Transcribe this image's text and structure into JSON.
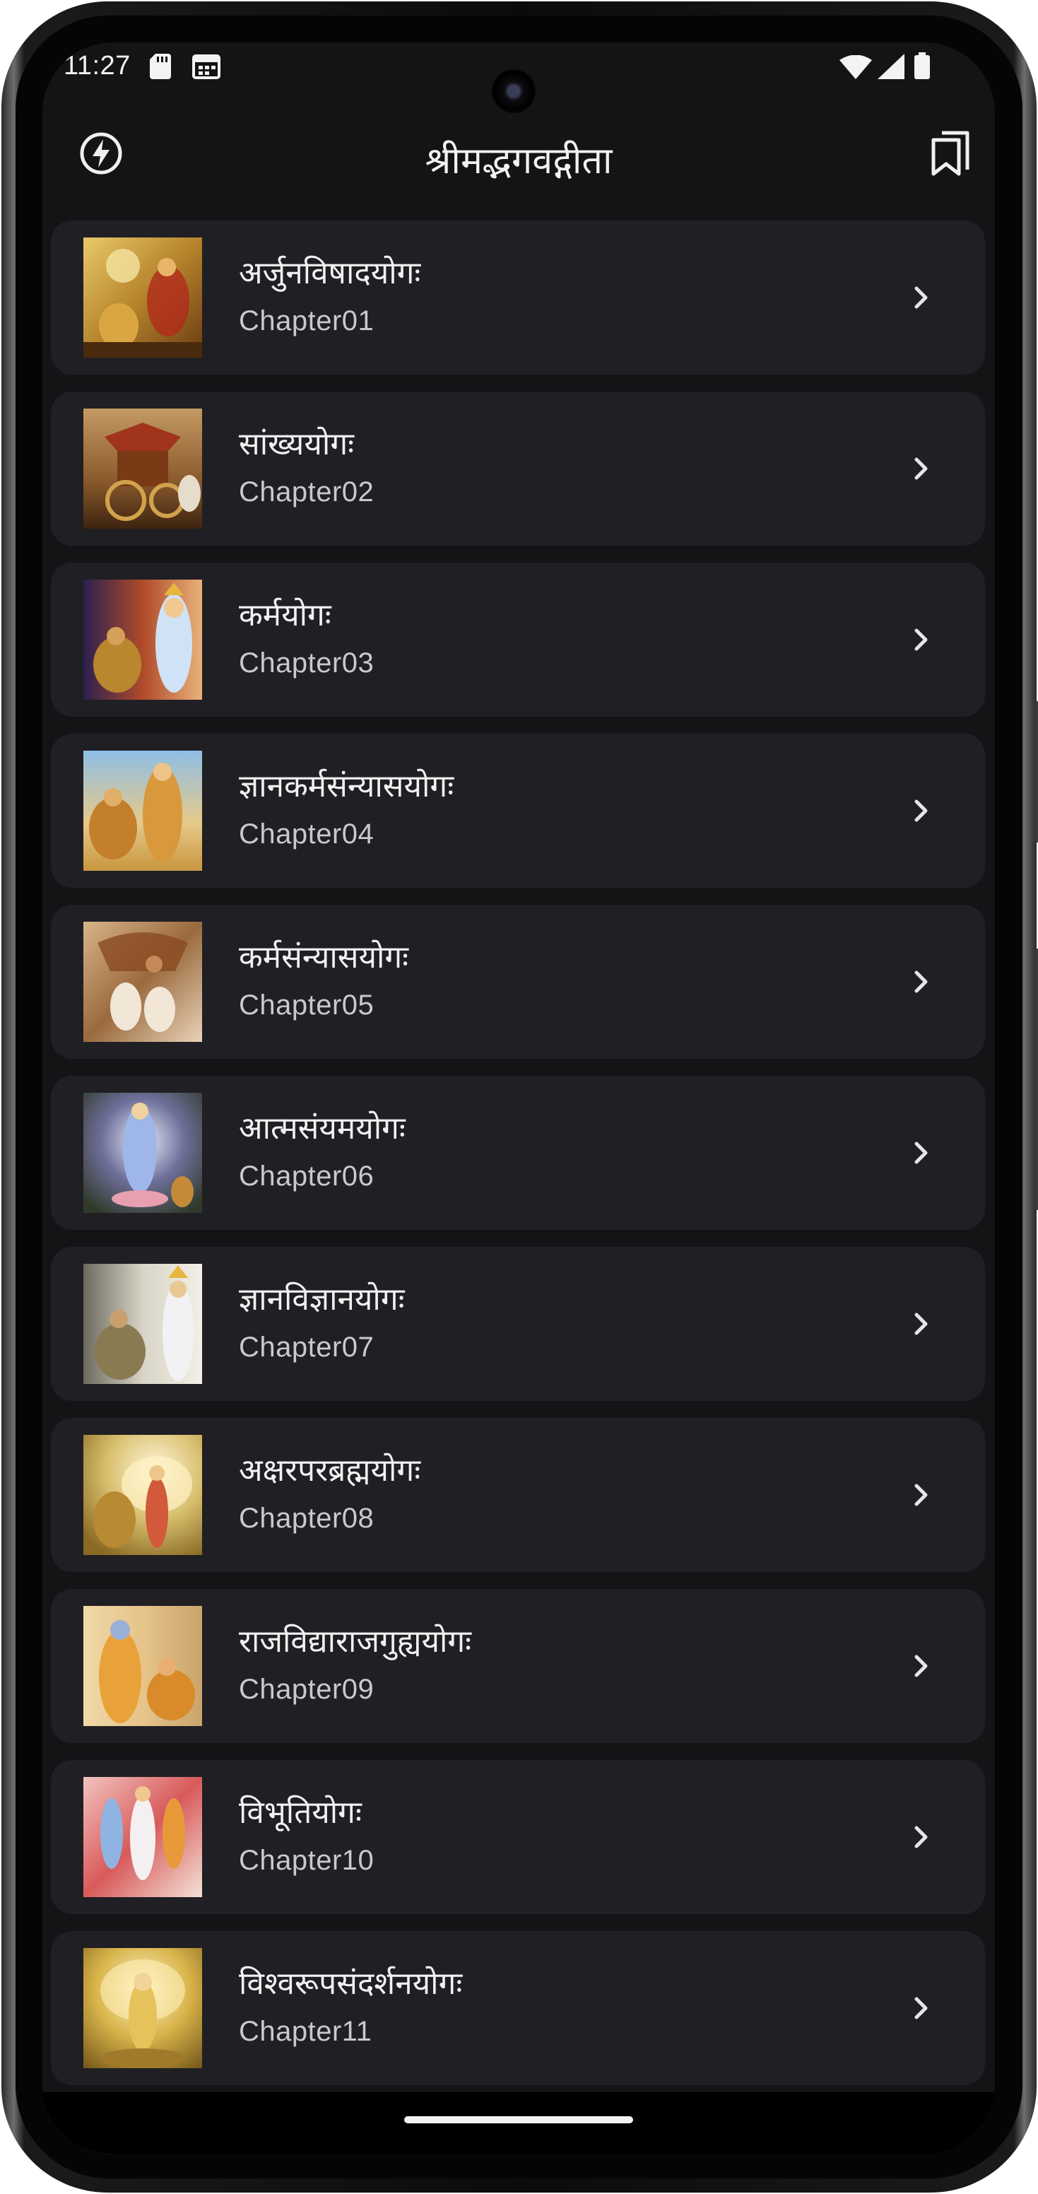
{
  "status_bar": {
    "time": "11:27",
    "icons": [
      "sd-card-icon",
      "calendar-icon",
      "wifi-icon",
      "cell-signal-icon",
      "battery-icon"
    ]
  },
  "app_bar": {
    "title": "श्रीमद्भगवद्गीता",
    "left_icon": "flash-icon",
    "right_icon": "bookmarks-icon"
  },
  "chapters": [
    {
      "title": "अर्जुनविषादयोगः",
      "subtitle": "Chapter01"
    },
    {
      "title": "सांख्ययोगः",
      "subtitle": "Chapter02"
    },
    {
      "title": "कर्मयोगः",
      "subtitle": "Chapter03"
    },
    {
      "title": "ज्ञानकर्मसंन्यासयोगः",
      "subtitle": "Chapter04"
    },
    {
      "title": "कर्मसंन्यासयोगः",
      "subtitle": "Chapter05"
    },
    {
      "title": "आत्मसंयमयोगः",
      "subtitle": "Chapter06"
    },
    {
      "title": "ज्ञानविज्ञानयोगः",
      "subtitle": "Chapter07"
    },
    {
      "title": "अक्षरपरब्रह्मयोगः",
      "subtitle": "Chapter08"
    },
    {
      "title": "राजविद्याराजगुह्ययोगः",
      "subtitle": "Chapter09"
    },
    {
      "title": "विभूतियोगः",
      "subtitle": "Chapter10"
    },
    {
      "title": "विश्वरूपसंदर्शनयोगः",
      "subtitle": "Chapter11"
    }
  ],
  "colors": {
    "background": "#141316",
    "card": "#201f24",
    "title_text": "#f1f1f1",
    "subtitle_text": "#c9c9cc"
  }
}
